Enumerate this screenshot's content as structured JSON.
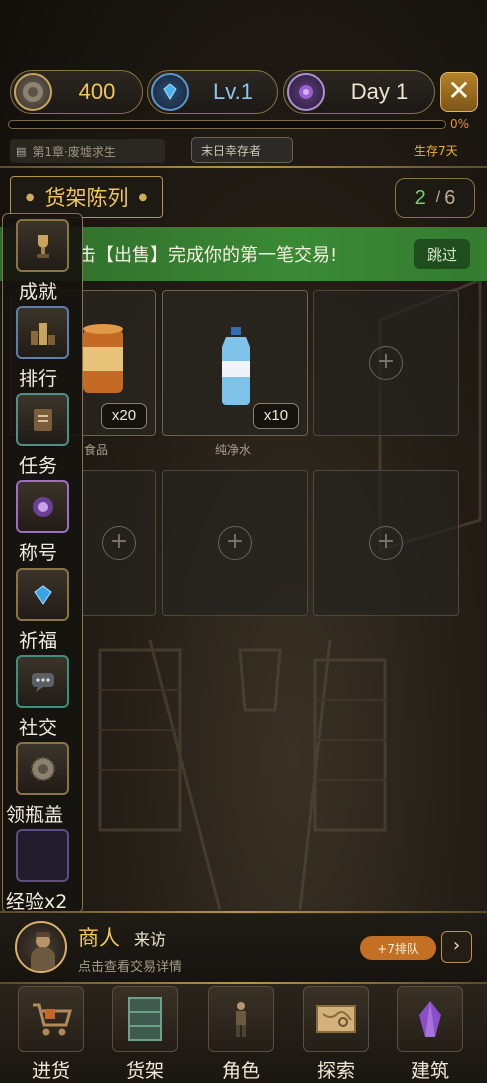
{
  "topbar": {
    "coins": "400",
    "level": "Lv.1",
    "day": "Day 1",
    "close_label": "✕"
  },
  "progress": {
    "percent_label": "0%",
    "value": 0
  },
  "status": {
    "chapter": "第1章·废墟求生",
    "role": "末日幸存者",
    "survive": "生存7天"
  },
  "shelf": {
    "title": "货架陈列",
    "used": "2",
    "sep": "/",
    "total": "6"
  },
  "tutorial": {
    "message": "击【出售】完成你的第一笔交易!",
    "skip_label": "跳过"
  },
  "slots": [
    {
      "name": "食品",
      "qty": "x20"
    },
    {
      "name": "纯净水",
      "qty": "x10"
    }
  ],
  "sidemenu": [
    {
      "label": "成就",
      "icon": "trophy-icon"
    },
    {
      "label": "排行",
      "icon": "ranking-icon"
    },
    {
      "label": "任务",
      "icon": "task-icon"
    },
    {
      "label": "称号",
      "icon": "title-badge-icon"
    },
    {
      "label": "祈福",
      "icon": "blessing-gem-icon"
    },
    {
      "label": "社交",
      "icon": "chat-icon"
    },
    {
      "label": "领瓶盖",
      "icon": "bottle-cap-icon"
    },
    {
      "label": "经验x2",
      "icon": "exp-boost-icon"
    }
  ],
  "merchant": {
    "title": "商人",
    "visit": "来访",
    "hint": "点击查看交易详情",
    "queue": "+7排队",
    "arrow": "›"
  },
  "nav": [
    {
      "label": "进货",
      "icon": "restock-cart-icon"
    },
    {
      "label": "货架",
      "icon": "shelf-icon"
    },
    {
      "label": "角色",
      "icon": "character-icon"
    },
    {
      "label": "探索",
      "icon": "map-scroll-icon"
    },
    {
      "label": "建筑",
      "icon": "crystal-building-icon"
    }
  ],
  "colors": {
    "gold": "#f2c75b",
    "tutorial_green": "#3a8a35",
    "queue_orange": "#c36f24",
    "slot_used": "#6fd07a"
  }
}
